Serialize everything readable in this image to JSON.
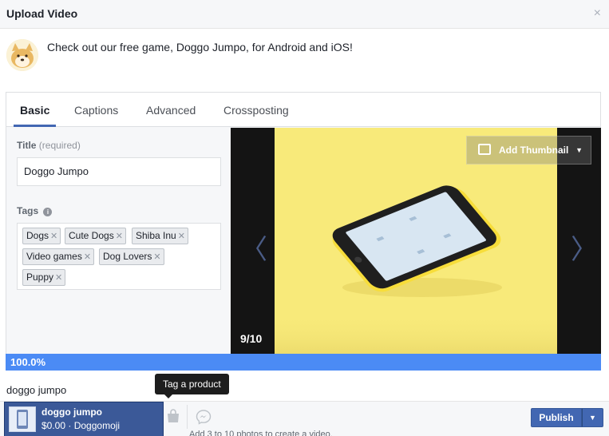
{
  "dialog": {
    "title": "Upload Video",
    "close_label": "×"
  },
  "post": {
    "text": "Check out our free game, Doggo Jumpo, for Android and iOS!"
  },
  "tabs": [
    {
      "label": "Basic",
      "active": true
    },
    {
      "label": "Captions",
      "active": false
    },
    {
      "label": "Advanced",
      "active": false
    },
    {
      "label": "Crossposting",
      "active": false
    }
  ],
  "form": {
    "title_label": "Title",
    "title_hint": "(required)",
    "title_value": "Doggo Jumpo",
    "tags_label": "Tags",
    "tags": [
      "Dogs",
      "Cute Dogs",
      "Shiba Inu",
      "Video games",
      "Dog Lovers",
      "Puppy"
    ]
  },
  "preview": {
    "counter": "9/10",
    "add_thumbnail_label": "Add Thumbnail",
    "prev_arrow": "〈",
    "next_arrow": "〉"
  },
  "upload": {
    "progress_text": "100.0%",
    "progress": 1.0
  },
  "caption": {
    "text": "doggo jumpo"
  },
  "tooltip": {
    "text": "Tag a product"
  },
  "product": {
    "name": "doggo jumpo",
    "price": "$0.00",
    "separator": "·",
    "store": "Doggomoji"
  },
  "footer": {
    "behind_text": "Add 3 to 10 photos to create a video.",
    "publish_label": "Publish",
    "publish_caret": "▼"
  },
  "icons": [
    "close-icon",
    "avatar",
    "info-icon",
    "image-add-icon",
    "chevron-left-icon",
    "chevron-right-icon",
    "shopping-bag-icon",
    "messenger-icon",
    "caret-down-icon"
  ],
  "colors": {
    "accent": "#4267b2",
    "progress": "#4b8bf5",
    "preview_yellow": "#f8ea7a",
    "phone_yellow": "#f7dd3a"
  }
}
